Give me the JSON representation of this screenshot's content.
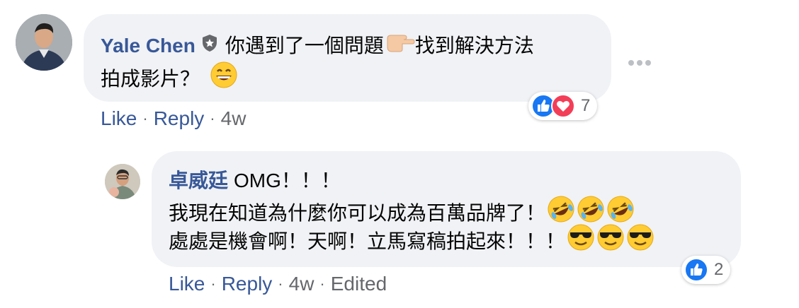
{
  "comment": {
    "author": "Yale Chen",
    "text_line1": "你遇到了一個問題",
    "text_line1b": "找到解決方法",
    "text_line2": "拍成影片？",
    "actions": {
      "like": "Like",
      "reply": "Reply",
      "time": "4w"
    },
    "reaction_count": "7"
  },
  "reply": {
    "author": "卓威廷",
    "text_line1": "OMG！！！",
    "text_line2": "我現在知道為什麼你可以成為百萬品牌了！",
    "text_line3": "處處是機會啊！天啊！立馬寫稿拍起來！！！",
    "actions": {
      "like": "Like",
      "reply": "Reply",
      "time": "4w",
      "edited": "Edited"
    },
    "reaction_count": "2"
  },
  "icons": {
    "badge": "shield-badge-icon",
    "like": "like-reaction-icon",
    "love": "love-reaction-icon",
    "more": "more-options-icon"
  },
  "colors": {
    "author": "#385898",
    "bubble": "#f0f2f5",
    "like": "#1877f2",
    "love": "#f33e58",
    "meta": "#65676b"
  }
}
